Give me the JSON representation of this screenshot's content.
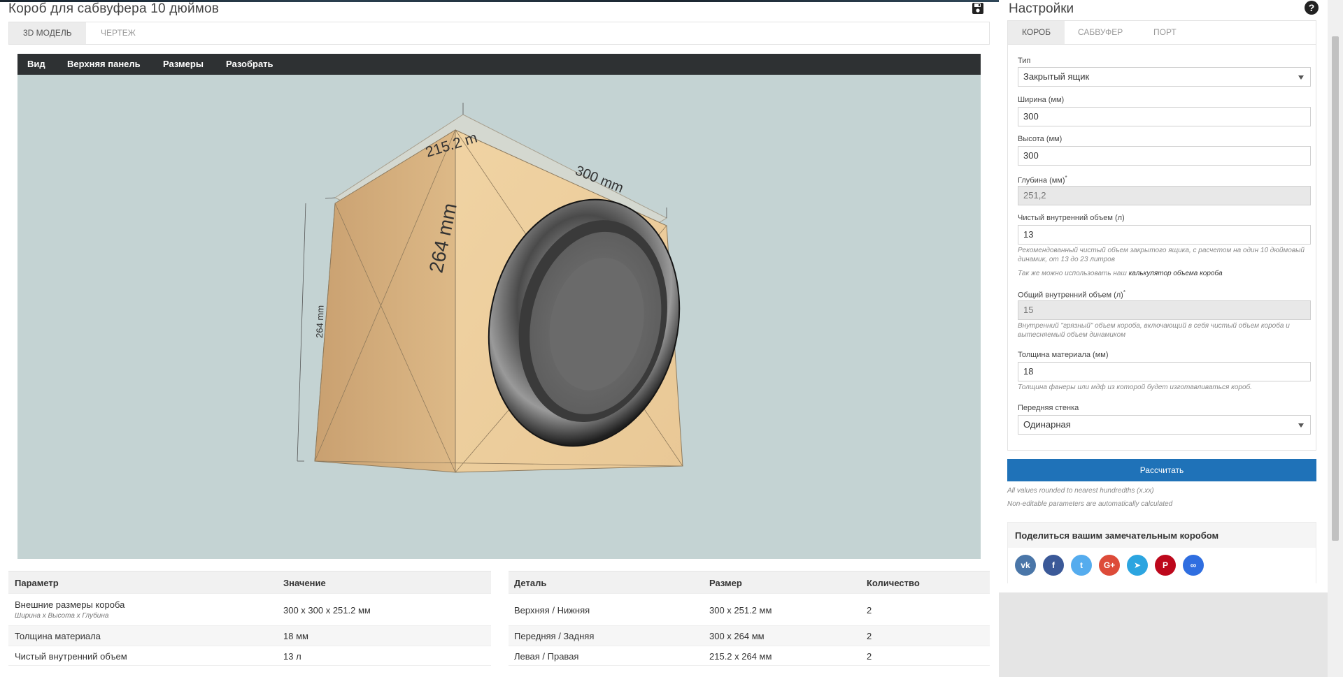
{
  "page": {
    "title": "Короб для сабвуфера 10 дюймов"
  },
  "left_tabs": [
    "3D МОДЕЛЬ",
    "ЧЕРТЕЖ"
  ],
  "viewer_menu": [
    "Вид",
    "Верхняя панель",
    "Размеры",
    "Разобрать"
  ],
  "model_dims": {
    "depth": "215.2 m",
    "width": "300 mm",
    "height_front": "264 mm",
    "height_side": "264 mm"
  },
  "params_table": {
    "headers": [
      "Параметр",
      "Значение"
    ],
    "rows": [
      {
        "param": "Внешние размеры короба",
        "sub": "Ширина х Высота х Глубина",
        "value": "300 x 300 x 251.2 мм"
      },
      {
        "param": "Толщина материала",
        "value": "18 мм"
      },
      {
        "param": "Чистый внутренний объем",
        "value": "13 л"
      }
    ]
  },
  "parts_table": {
    "headers": [
      "Деталь",
      "Размер",
      "Количество"
    ],
    "rows": [
      {
        "part": "Верхняя / Нижняя",
        "size": "300 x 251.2 мм",
        "qty": "2"
      },
      {
        "part": "Передняя / Задняя",
        "size": "300 x 264 мм",
        "qty": "2"
      },
      {
        "part": "Левая / Правая",
        "size": "215.2 x 264 мм",
        "qty": "2"
      }
    ]
  },
  "settings": {
    "title": "Настройки",
    "help": "?",
    "tabs": [
      "КОРОБ",
      "САБВУФЕР",
      "ПОРТ"
    ],
    "type_label": "Тип",
    "type_value": "Закрытый ящик",
    "width_label": "Ширина (мм)",
    "width_value": "300",
    "height_label": "Высота (мм)",
    "height_value": "300",
    "depth_label": "Глубина (мм)",
    "depth_value": "251,2",
    "net_label": "Чистый внутренний объем (л)",
    "net_value": "13",
    "net_hint": "Рекомендованный чистый объем закрытого ящика, с расчетом на один 10 дюймовый динамик, от 13 до 23 литров",
    "calc_hint_prefix": "Так же можно использовать наш",
    "calc_hint_link": "калькулятор объема короба",
    "gross_label": "Общий внутренний объем (л)",
    "gross_value": "15",
    "gross_hint": "Внутренний \"грязный\" объем короба, включающий в себя чистый объем короба и вытесняемый объем динамиком",
    "thickness_label": "Толщина материала (мм)",
    "thickness_value": "18",
    "thickness_hint": "Толщина фанеры или мдф из которой будет изготавливаться короб.",
    "front_label": "Передняя стенка",
    "front_value": "Одинарная",
    "star": "*"
  },
  "calc_button": "Рассчитать",
  "notes": [
    "All values rounded to nearest hundredths (x.xx)",
    "Non-editable parameters are automatically calculated"
  ],
  "share": {
    "title": "Поделиться вашим замечательным коробом",
    "icons": [
      {
        "name": "vk-icon",
        "glyph": "vk",
        "color": "#4a76a8"
      },
      {
        "name": "facebook-icon",
        "glyph": "f",
        "color": "#3b5998"
      },
      {
        "name": "twitter-icon",
        "glyph": "t",
        "color": "#55acee"
      },
      {
        "name": "googleplus-icon",
        "glyph": "G+",
        "color": "#dd4b39"
      },
      {
        "name": "telegram-icon",
        "glyph": "➤",
        "color": "#2ca5e0"
      },
      {
        "name": "pinterest-icon",
        "glyph": "P",
        "color": "#bd081c"
      },
      {
        "name": "link-icon",
        "glyph": "∞",
        "color": "#2f6ee0"
      }
    ]
  }
}
